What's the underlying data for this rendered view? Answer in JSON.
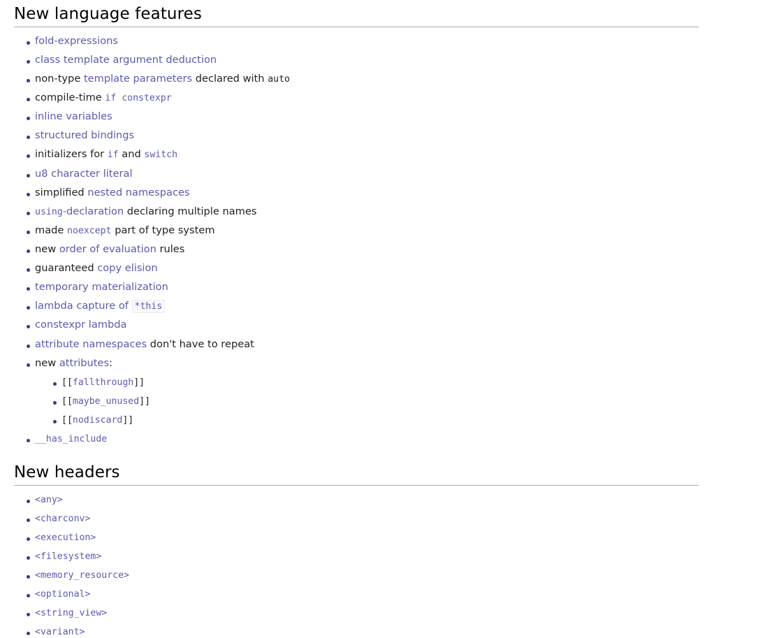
{
  "theme": {
    "background": "#ffffff",
    "text_color": "#202122",
    "link_color": "#5a5ab0",
    "bullet_color": "#3b3b7a",
    "rule_color": "#a2a9b1",
    "code_bg": "#f8f9fa",
    "code_border": "#eaecf0"
  },
  "sections": [
    {
      "id": "new-language-features",
      "heading": "New language features",
      "lists": [
        {
          "id": "language-features-primary",
          "items": [
            {
              "id": "fold-expressions",
              "runs": [
                {
                  "text": "fold-expressions",
                  "style": "link"
                }
              ]
            },
            {
              "id": "class-template-argument-deduction",
              "runs": [
                {
                  "text": "class template argument deduction",
                  "style": "link"
                }
              ]
            },
            {
              "id": "non-type-template-parameters-auto",
              "runs": [
                {
                  "text": "non-type ",
                  "style": "text"
                },
                {
                  "text": "template parameters",
                  "style": "link"
                },
                {
                  "text": " declared with ",
                  "style": "text"
                },
                {
                  "text": "auto",
                  "style": "mono-text"
                }
              ]
            },
            {
              "id": "compile-time-if-constexpr",
              "runs": [
                {
                  "text": "compile-time ",
                  "style": "text"
                },
                {
                  "text": "if constexpr",
                  "style": "mono-link"
                }
              ]
            },
            {
              "id": "inline-variables",
              "runs": [
                {
                  "text": "inline variables",
                  "style": "link"
                }
              ]
            },
            {
              "id": "structured-bindings",
              "runs": [
                {
                  "text": "structured bindings",
                  "style": "link"
                }
              ]
            },
            {
              "id": "initializers-for-if-and-switch",
              "runs": [
                {
                  "text": "initializers for ",
                  "style": "text"
                },
                {
                  "text": "if",
                  "style": "mono-link"
                },
                {
                  "text": " and ",
                  "style": "text"
                },
                {
                  "text": "switch",
                  "style": "mono-link"
                }
              ]
            },
            {
              "id": "u8-character-literal",
              "runs": [
                {
                  "text": "u8 character literal",
                  "style": "link"
                }
              ]
            },
            {
              "id": "simplified-nested-namespaces",
              "runs": [
                {
                  "text": "simplified ",
                  "style": "text"
                },
                {
                  "text": "nested namespaces",
                  "style": "link"
                }
              ]
            },
            {
              "id": "using-declaration-multiple-names",
              "runs": [
                {
                  "text": "using",
                  "style": "mono-link"
                },
                {
                  "text": "-declaration",
                  "style": "link"
                },
                {
                  "text": " declaring multiple names",
                  "style": "text"
                }
              ]
            },
            {
              "id": "made-noexcept-part-of-type-system",
              "runs": [
                {
                  "text": "made ",
                  "style": "text"
                },
                {
                  "text": "noexcept",
                  "style": "mono-link"
                },
                {
                  "text": " part of type system",
                  "style": "text"
                }
              ]
            },
            {
              "id": "new-order-of-evaluation-rules",
              "runs": [
                {
                  "text": "new ",
                  "style": "text"
                },
                {
                  "text": "order of evaluation",
                  "style": "link"
                },
                {
                  "text": " rules",
                  "style": "text"
                }
              ]
            }
          ]
        },
        {
          "id": "language-features-secondary",
          "items": [
            {
              "id": "guaranteed-copy-elision",
              "runs": [
                {
                  "text": "guaranteed ",
                  "style": "text"
                },
                {
                  "text": "copy elision",
                  "style": "link"
                }
              ]
            },
            {
              "id": "temporary-materialization",
              "runs": [
                {
                  "text": "temporary materialization",
                  "style": "link"
                }
              ]
            },
            {
              "id": "lambda-capture-of-this",
              "runs": [
                {
                  "text": "lambda capture of ",
                  "style": "link"
                },
                {
                  "text": "*this",
                  "style": "codebox"
                }
              ]
            },
            {
              "id": "constexpr-lambda",
              "runs": [
                {
                  "text": "constexpr lambda",
                  "style": "link"
                }
              ]
            },
            {
              "id": "attribute-namespaces-no-repeat",
              "runs": [
                {
                  "text": "attribute namespaces",
                  "style": "link"
                },
                {
                  "text": " don't have to repeat",
                  "style": "text"
                }
              ]
            },
            {
              "id": "new-attributes",
              "runs": [
                {
                  "text": "new ",
                  "style": "text"
                },
                {
                  "text": "attributes",
                  "style": "link"
                },
                {
                  "text": ":",
                  "style": "text"
                }
              ],
              "sub_items": [
                {
                  "id": "attr-fallthrough",
                  "runs": [
                    {
                      "text": "[[",
                      "style": "mono-text"
                    },
                    {
                      "text": "fallthrough",
                      "style": "mono-link"
                    },
                    {
                      "text": "]]",
                      "style": "mono-text"
                    }
                  ]
                },
                {
                  "id": "attr-maybe-unused",
                  "runs": [
                    {
                      "text": "[[",
                      "style": "mono-text"
                    },
                    {
                      "text": "maybe_unused",
                      "style": "mono-link"
                    },
                    {
                      "text": "]]",
                      "style": "mono-text"
                    }
                  ]
                },
                {
                  "id": "attr-nodiscard",
                  "runs": [
                    {
                      "text": "[[",
                      "style": "mono-text"
                    },
                    {
                      "text": "nodiscard",
                      "style": "mono-link"
                    },
                    {
                      "text": "]]",
                      "style": "mono-text"
                    }
                  ]
                }
              ]
            },
            {
              "id": "has-include",
              "runs": [
                {
                  "text": "__has_include",
                  "style": "mono-link"
                }
              ]
            }
          ]
        }
      ]
    },
    {
      "id": "new-headers",
      "heading": "New headers",
      "lists": [
        {
          "id": "headers-list",
          "items": [
            {
              "id": "header-any",
              "runs": [
                {
                  "text": "<any>",
                  "style": "mono-link"
                }
              ]
            },
            {
              "id": "header-charconv",
              "runs": [
                {
                  "text": "<charconv>",
                  "style": "mono-link"
                }
              ]
            },
            {
              "id": "header-execution",
              "runs": [
                {
                  "text": "<execution>",
                  "style": "mono-link"
                }
              ]
            },
            {
              "id": "header-filesystem",
              "runs": [
                {
                  "text": "<filesystem>",
                  "style": "mono-link"
                }
              ]
            },
            {
              "id": "header-memory-resource",
              "runs": [
                {
                  "text": "<memory_resource>",
                  "style": "mono-link"
                }
              ]
            },
            {
              "id": "header-optional",
              "runs": [
                {
                  "text": "<optional>",
                  "style": "mono-link"
                }
              ]
            },
            {
              "id": "header-string-view",
              "runs": [
                {
                  "text": "<string_view>",
                  "style": "mono-link"
                }
              ]
            },
            {
              "id": "header-variant",
              "runs": [
                {
                  "text": "<variant>",
                  "style": "mono-link"
                }
              ]
            }
          ]
        }
      ]
    }
  ]
}
